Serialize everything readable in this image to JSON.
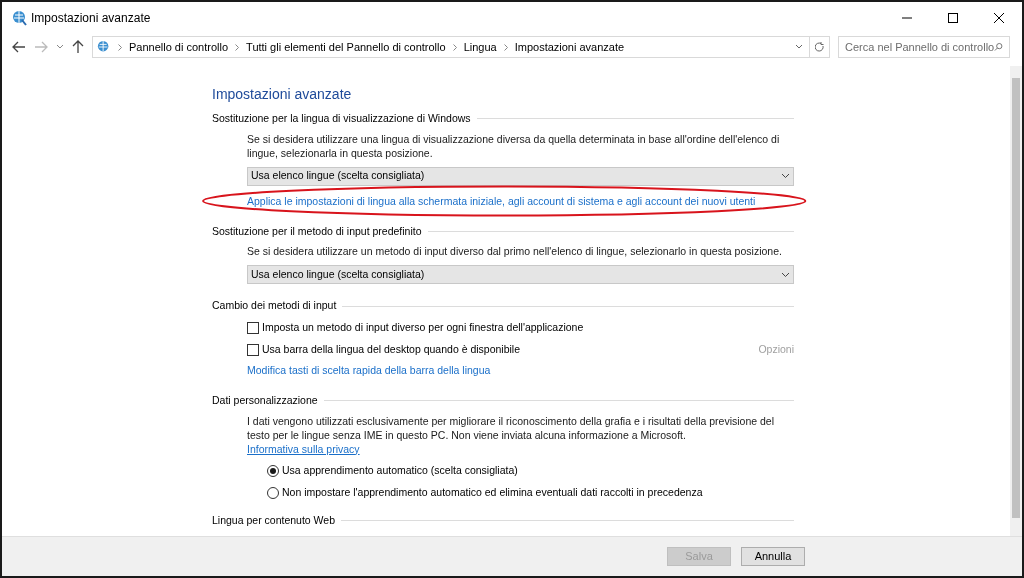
{
  "window": {
    "title": "Impostazioni avanzate"
  },
  "address_bar": {
    "breadcrumbs": [
      "Pannello di controllo",
      "Tutti gli elementi del Pannello di controllo",
      "Lingua",
      "Impostazioni avanzate"
    ]
  },
  "search": {
    "placeholder": "Cerca nel Pannello di controllo"
  },
  "page_title": "Impostazioni avanzate",
  "sections": [
    {
      "heading": "Sostituzione per la lingua di visualizzazione di Windows",
      "items": [
        {
          "kind": "text",
          "text": "Se si desidera utilizzare una lingua di visualizzazione diversa da quella determinata in base all'ordine dell'elenco di lingue, selezionarla in questa posizione."
        },
        {
          "kind": "dropdown",
          "value": "Usa elenco lingue (scelta consigliata)"
        },
        {
          "kind": "link",
          "text": "Applica le impostazioni di lingua alla schermata iniziale, agli account di sistema e agli account dei nuovi utenti",
          "highlighted": true
        }
      ]
    },
    {
      "heading": "Sostituzione per il metodo di input predefinito",
      "items": [
        {
          "kind": "text",
          "text": "Se si desidera utilizzare un metodo di input diverso dal primo nell'elenco di lingue, selezionarlo in questa posizione."
        },
        {
          "kind": "dropdown",
          "value": "Usa elenco lingue (scelta consigliata)"
        }
      ]
    },
    {
      "heading": "Cambio dei metodi di input",
      "items": [
        {
          "kind": "checkbox",
          "label": "Imposta un metodo di input diverso per ogni finestra dell'applicazione",
          "checked": false
        },
        {
          "kind": "checkbox",
          "label": "Usa barra della lingua del desktop quando è disponibile",
          "checked": false,
          "option": "Opzioni"
        },
        {
          "kind": "link",
          "text": "Modifica tasti di scelta rapida della barra della lingua",
          "highlighted": false
        }
      ]
    },
    {
      "heading": "Dati personalizzazione",
      "items": [
        {
          "kind": "text",
          "text": "I dati vengono utilizzati esclusivamente per migliorare il riconoscimento della grafia e i risultati della previsione del testo per le lingue senza IME in questo PC. Non viene inviata alcuna informazione a Microsoft.",
          "link": "Informativa sulla privacy"
        },
        {
          "kind": "radio",
          "label": "Usa apprendimento automatico (scelta consigliata)",
          "selected": true
        },
        {
          "kind": "radio",
          "label": "Non impostare l'apprendimento automatico ed elimina eventuali dati raccolti in precedenza",
          "selected": false
        }
      ]
    },
    {
      "heading": "Lingua per contenuto Web"
    }
  ],
  "buttons": [
    {
      "label": "Salva",
      "disabled": true
    },
    {
      "label": "Annulla",
      "disabled": false
    }
  ]
}
